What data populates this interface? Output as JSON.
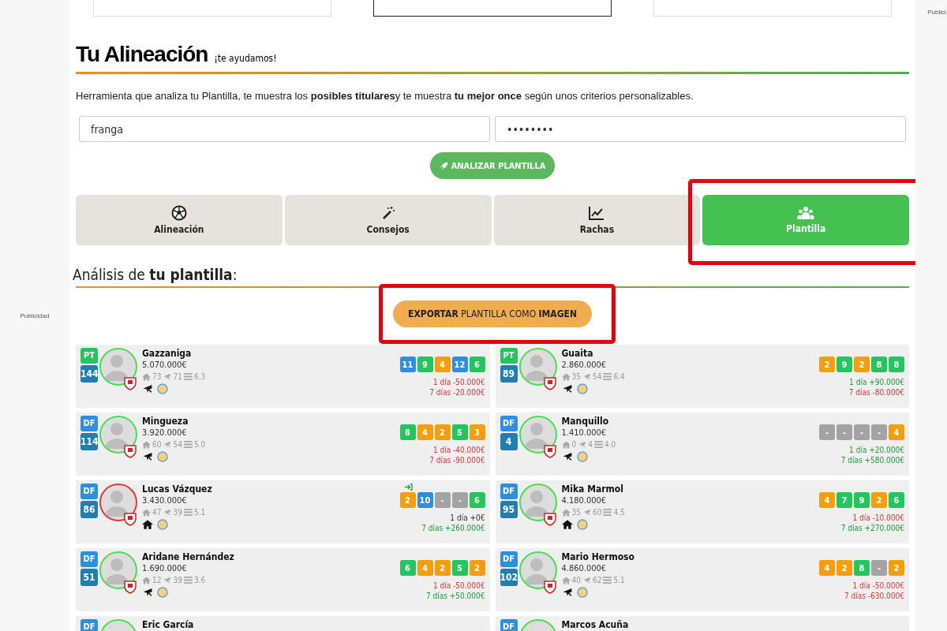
{
  "side_ads": [
    "Publicidad",
    "Publici"
  ],
  "header": {
    "title": "Tu Alineación",
    "tagline": "¡te ayudamos!"
  },
  "intro": "Herramienta que analiza tu Plantilla, te muestra los **posibles titulares**y te muestra **tu mejor once** según unos criterios personalizables.",
  "login": {
    "user": "franga",
    "password": "••••••••"
  },
  "analyze_button": "ANALIZAR PLANTILLA",
  "tabs": [
    {
      "label": "Alineación",
      "kind": "ball",
      "selected": false,
      "highlighted": false
    },
    {
      "label": "Consejos",
      "kind": "wand",
      "selected": false,
      "highlighted": false
    },
    {
      "label": "Rachas",
      "kind": "chart",
      "selected": false,
      "highlighted": false
    },
    {
      "label": "Plantilla",
      "kind": "group",
      "selected": true,
      "highlighted": true
    }
  ],
  "section_title": "Análisis de **tu plantilla**:",
  "export_button": {
    "label": "**EXPORTAR** PLANTILLA COMO **IMAGEN**",
    "highlighted": true
  },
  "players": [
    {
      "kind": "full",
      "name": "Gazzaniga",
      "position": "PT",
      "points": "144",
      "price": "5.070.000€",
      "home": "73",
      "away": "71",
      "avg": "6.3",
      "at_home": false,
      "warning": false,
      "entry_icon": false,
      "scores": [
        {
          "value": "11",
          "color": "#2d8fe0"
        },
        {
          "value": "9",
          "color": "#22c55e"
        },
        {
          "value": "4",
          "color": "#f59e0b"
        },
        {
          "value": "12",
          "color": "#2d8fe0"
        },
        {
          "value": "6",
          "color": "#22c55e"
        }
      ],
      "changes": [
        {
          "text": "1 día -50.000€",
          "kind": "fall"
        },
        {
          "text": "7 días -20.000€",
          "kind": "fall"
        }
      ]
    },
    {
      "kind": "full",
      "name": "Guaita",
      "position": "PT",
      "points": "89",
      "price": "2.860.000€",
      "home": "35",
      "away": "54",
      "avg": "6.4",
      "at_home": false,
      "warning": false,
      "entry_icon": false,
      "scores": [
        {
          "value": "2",
          "color": "#f59e0b"
        },
        {
          "value": "9",
          "color": "#22c55e"
        },
        {
          "value": "2",
          "color": "#f59e0b"
        },
        {
          "value": "8",
          "color": "#22c55e"
        },
        {
          "value": "8",
          "color": "#22c55e"
        }
      ],
      "changes": [
        {
          "text": "1 día +90.000€",
          "kind": "rise"
        },
        {
          "text": "7 días -80.000€",
          "kind": "fall"
        }
      ]
    },
    {
      "kind": "full",
      "name": "Mingueza",
      "position": "DF",
      "points": "114",
      "price": "3.920.000€",
      "home": "60",
      "away": "54",
      "avg": "5.0",
      "at_home": false,
      "warning": false,
      "entry_icon": false,
      "scores": [
        {
          "value": "8",
          "color": "#22c55e"
        },
        {
          "value": "4",
          "color": "#f59e0b"
        },
        {
          "value": "2",
          "color": "#f59e0b"
        },
        {
          "value": "5",
          "color": "#22c55e"
        },
        {
          "value": "3",
          "color": "#f59e0b"
        }
      ],
      "changes": [
        {
          "text": "1 día -40.000€",
          "kind": "fall"
        },
        {
          "text": "7 días -90.000€",
          "kind": "fall"
        }
      ]
    },
    {
      "kind": "full",
      "name": "Manquillo",
      "position": "DF",
      "points": "4",
      "price": "1.410.000€",
      "home": "0",
      "away": "4",
      "avg": "4.0",
      "at_home": false,
      "warning": false,
      "entry_icon": false,
      "scores": [
        {
          "value": "-",
          "color": "#a3a3a3"
        },
        {
          "value": "-",
          "color": "#a3a3a3"
        },
        {
          "value": "-",
          "color": "#a3a3a3"
        },
        {
          "value": "-",
          "color": "#a3a3a3"
        },
        {
          "value": "4",
          "color": "#f59e0b"
        }
      ],
      "changes": [
        {
          "text": "1 día +20.000€",
          "kind": "rise"
        },
        {
          "text": "7 días +580.000€",
          "kind": "rise"
        }
      ]
    },
    {
      "kind": "full",
      "name": "Lucas Vázquez",
      "position": "DF",
      "points": "86",
      "price": "3.430.000€",
      "home": "47",
      "away": "39",
      "avg": "5.1",
      "at_home": true,
      "warning": true,
      "entry_icon": true,
      "scores": [
        {
          "value": "2",
          "color": "#f59e0b"
        },
        {
          "value": "10",
          "color": "#2d8fe0"
        },
        {
          "value": "-",
          "color": "#a3a3a3"
        },
        {
          "value": "-",
          "color": "#a3a3a3"
        },
        {
          "value": "6",
          "color": "#22c55e"
        }
      ],
      "changes": [
        {
          "text": "1 día +0€",
          "kind": "flat"
        },
        {
          "text": "7 días +260.000€",
          "kind": "rise"
        }
      ]
    },
    {
      "kind": "full",
      "name": "Mika Marmol",
      "position": "DF",
      "points": "95",
      "price": "4.180.000€",
      "home": "35",
      "away": "60",
      "avg": "4.5",
      "at_home": true,
      "warning": false,
      "entry_icon": false,
      "scores": [
        {
          "value": "4",
          "color": "#f59e0b"
        },
        {
          "value": "7",
          "color": "#22c55e"
        },
        {
          "value": "9",
          "color": "#22c55e"
        },
        {
          "value": "2",
          "color": "#f59e0b"
        },
        {
          "value": "6",
          "color": "#22c55e"
        }
      ],
      "changes": [
        {
          "text": "1 día -10.000€",
          "kind": "fall"
        },
        {
          "text": "7 días +270.000€",
          "kind": "rise"
        }
      ]
    },
    {
      "kind": "full",
      "name": "Aridane Hernández",
      "position": "DF",
      "points": "51",
      "price": "1.690.000€",
      "home": "12",
      "away": "39",
      "avg": "3.6",
      "at_home": false,
      "warning": false,
      "entry_icon": false,
      "scores": [
        {
          "value": "6",
          "color": "#22c55e"
        },
        {
          "value": "4",
          "color": "#f59e0b"
        },
        {
          "value": "2",
          "color": "#f59e0b"
        },
        {
          "value": "5",
          "color": "#22c55e"
        },
        {
          "value": "2",
          "color": "#f59e0b"
        }
      ],
      "changes": [
        {
          "text": "1 día -50.000€",
          "kind": "fall"
        },
        {
          "text": "7 días +50.000€",
          "kind": "rise"
        }
      ]
    },
    {
      "kind": "full",
      "name": "Mario Hermoso",
      "position": "DF",
      "points": "102",
      "price": "4.860.000€",
      "home": "40",
      "away": "62",
      "avg": "5.1",
      "at_home": false,
      "warning": false,
      "entry_icon": false,
      "scores": [
        {
          "value": "4",
          "color": "#f59e0b"
        },
        {
          "value": "2",
          "color": "#f59e0b"
        },
        {
          "value": "8",
          "color": "#22c55e"
        },
        {
          "value": "-",
          "color": "#a3a3a3"
        },
        {
          "value": "2",
          "color": "#f59e0b"
        }
      ],
      "changes": [
        {
          "text": "1 día -50.000€",
          "kind": "fall"
        },
        {
          "text": "7 días -630.000€",
          "kind": "fall"
        }
      ]
    },
    {
      "kind": "partial",
      "name": "Eric García",
      "position": "DF"
    },
    {
      "kind": "partial",
      "name": "Marcos Acuña",
      "position": "DF"
    }
  ]
}
